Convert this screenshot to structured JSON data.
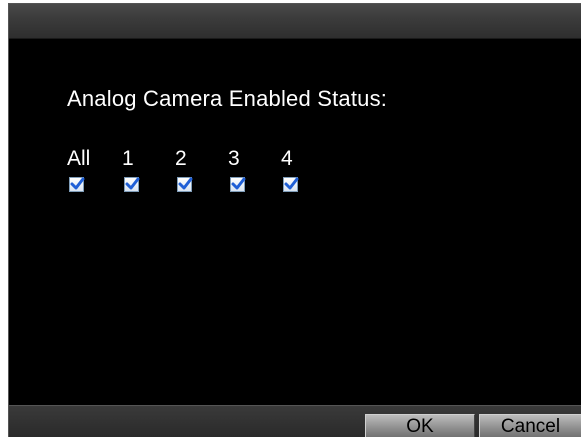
{
  "dialog": {
    "heading": "Analog Camera Enabled Status:"
  },
  "channels": [
    {
      "label": "All",
      "checked": true
    },
    {
      "label": "1",
      "checked": true
    },
    {
      "label": "2",
      "checked": true
    },
    {
      "label": "3",
      "checked": true
    },
    {
      "label": "4",
      "checked": true
    }
  ],
  "buttons": {
    "ok_label": "OK",
    "cancel_label": "Cancel"
  },
  "colors": {
    "background": "#000000",
    "checkmark": "#1f5fd6"
  }
}
